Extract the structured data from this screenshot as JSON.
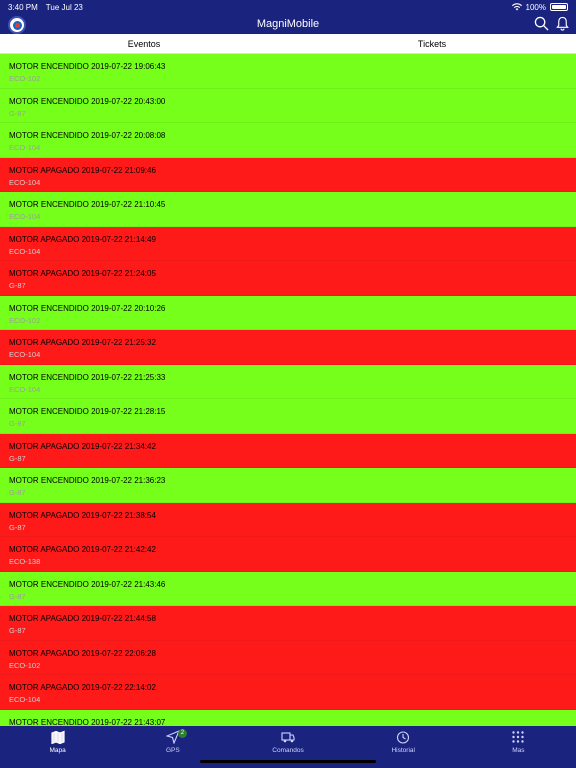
{
  "status_bar": {
    "time": "3:40 PM",
    "date": "Tue Jul 23",
    "battery": "100%"
  },
  "header": {
    "title": "MagniMobile",
    "icons": [
      "logo",
      "search-icon",
      "bell-icon"
    ]
  },
  "segments": [
    "Eventos",
    "Tickets"
  ],
  "events": [
    {
      "status": "on",
      "title": "MOTOR ENCENDIDO 2019-07-22 19:06:43",
      "unit": "ECO-102"
    },
    {
      "status": "on",
      "title": "MOTOR ENCENDIDO 2019-07-22 20:43:00",
      "unit": "G-87"
    },
    {
      "status": "on",
      "title": "MOTOR ENCENDIDO 2019-07-22 20:08:08",
      "unit": "ECO-104"
    },
    {
      "status": "off",
      "title": "MOTOR APAGADO 2019-07-22 21:09:46",
      "unit": "ECO-104"
    },
    {
      "status": "on",
      "title": "MOTOR ENCENDIDO 2019-07-22 21:10:45",
      "unit": "ECO-104"
    },
    {
      "status": "off",
      "title": "MOTOR APAGADO 2019-07-22 21:14:49",
      "unit": "ECO-104"
    },
    {
      "status": "off",
      "title": "MOTOR APAGADO 2019-07-22 21:24:05",
      "unit": "G-87"
    },
    {
      "status": "on",
      "title": "MOTOR ENCENDIDO 2019-07-22 20:10:26",
      "unit": "ECO-102"
    },
    {
      "status": "off",
      "title": "MOTOR APAGADO 2019-07-22 21:25:32",
      "unit": "ECO-104"
    },
    {
      "status": "on",
      "title": "MOTOR ENCENDIDO 2019-07-22 21:25:33",
      "unit": "ECO-104"
    },
    {
      "status": "on",
      "title": "MOTOR ENCENDIDO 2019-07-22 21:28:15",
      "unit": "G-87"
    },
    {
      "status": "off",
      "title": "MOTOR APAGADO 2019-07-22 21:34:42",
      "unit": "G-87"
    },
    {
      "status": "on",
      "title": "MOTOR ENCENDIDO 2019-07-22 21:36:23",
      "unit": "G-87"
    },
    {
      "status": "off",
      "title": "MOTOR APAGADO 2019-07-22 21:38:54",
      "unit": "G-87"
    },
    {
      "status": "off",
      "title": "MOTOR APAGADO 2019-07-22 21:42:42",
      "unit": "ECO-138"
    },
    {
      "status": "on",
      "title": "MOTOR ENCENDIDO 2019-07-22 21:43:46",
      "unit": "G-87"
    },
    {
      "status": "off",
      "title": "MOTOR APAGADO 2019-07-22 21:44:58",
      "unit": "G-87"
    },
    {
      "status": "off",
      "title": "MOTOR APAGADO 2019-07-22 22:06:28",
      "unit": "ECO-102"
    },
    {
      "status": "off",
      "title": "MOTOR APAGADO 2019-07-22 22:14:02",
      "unit": "ECO-104"
    },
    {
      "status": "on",
      "title": "MOTOR ENCENDIDO 2019-07-22 21:43:07",
      "unit": ""
    }
  ],
  "tabs": [
    {
      "label": "Mapa",
      "icon": "map-icon",
      "active": true
    },
    {
      "label": "GPS",
      "icon": "location-arrow-icon",
      "badge": "2"
    },
    {
      "label": "Comandos",
      "icon": "truck-icon"
    },
    {
      "label": "Historial",
      "icon": "clock-icon"
    },
    {
      "label": "Mas",
      "icon": "grid-icon"
    }
  ],
  "colors": {
    "nav": "#1a237e",
    "engine_on": "#76ff1a",
    "engine_off": "#ff1a1a"
  }
}
